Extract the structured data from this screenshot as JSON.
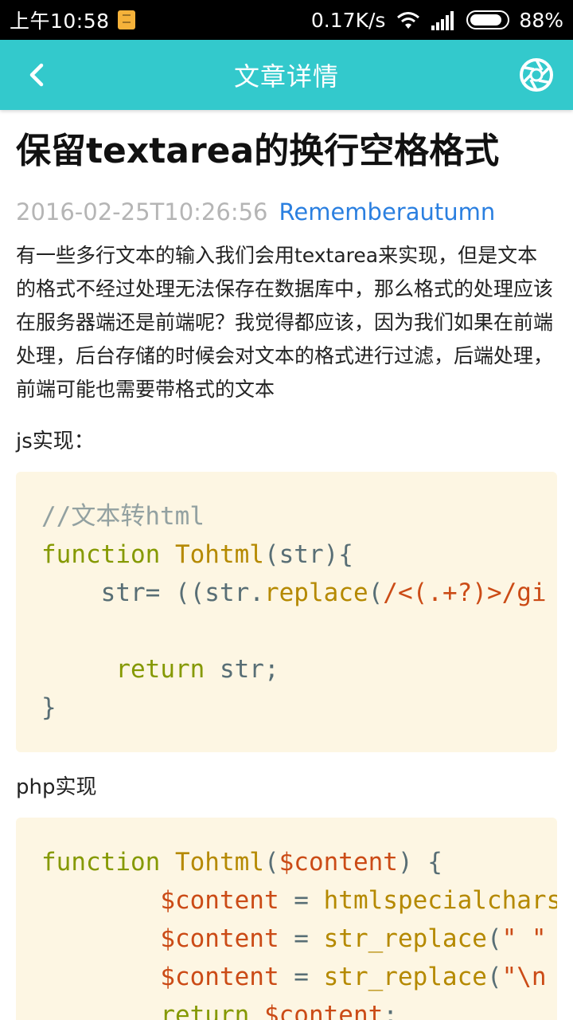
{
  "status_bar": {
    "time": "上午10:58",
    "net_speed": "0.17K/s",
    "battery": "88%",
    "battery_level": 0.88
  },
  "header": {
    "title": "文章详情",
    "back_icon": "chevron-left-icon",
    "right_icon": "camera-shutter-icon",
    "color": "#33c9cc"
  },
  "article": {
    "title": "保留textarea的换行空格格式",
    "date": "2016-02-25T10:26:56",
    "author": "Rememberautumn",
    "intro": "有一些多行文本的输入我们会用textarea来实现，但是文本的格式不经过处理无法保存在数据库中，那么格式的处理应该在服务器端还是前端呢？我觉得都应该，因为我们如果在前端处理，后台存储的时候会对文本的格式进行过滤，后端处理，前端可能也需要带格式的文本",
    "js_label": "js实现：",
    "js_code": {
      "line1": "//文本转html",
      "line2_kw": "function",
      "line2_fn": "Tohtml",
      "line2_rest": "(str){",
      "line3_a": "    str= ((str.",
      "line3_fn": "replace",
      "line3_b": "(",
      "line3_str": "/<(.+?)>/gi",
      "line5_kw": "return",
      "line5_rest": " str;",
      "line6": "}"
    },
    "php_label": "php实现",
    "php_code": {
      "line1_kw": "function",
      "line1_fn": "Tohtml",
      "line1_p1": "(",
      "line1_var": "$content",
      "line1_p2": ") {",
      "line2_var": "$content",
      "line2_eq": " = ",
      "line2_fn": "htmlspecialchars",
      "line3_var": "$content",
      "line3_eq": " = ",
      "line3_fn": "str_replace",
      "line3_p": "(",
      "line3_str": "\" \"",
      "line4_var": "$content",
      "line4_eq": " = ",
      "line4_fn": "str_replace",
      "line4_p": "(",
      "line4_str": "\"\\n",
      "line5_kw": "return",
      "line5_sp": " ",
      "line5_var": "$content",
      "line5_end": ";"
    }
  }
}
